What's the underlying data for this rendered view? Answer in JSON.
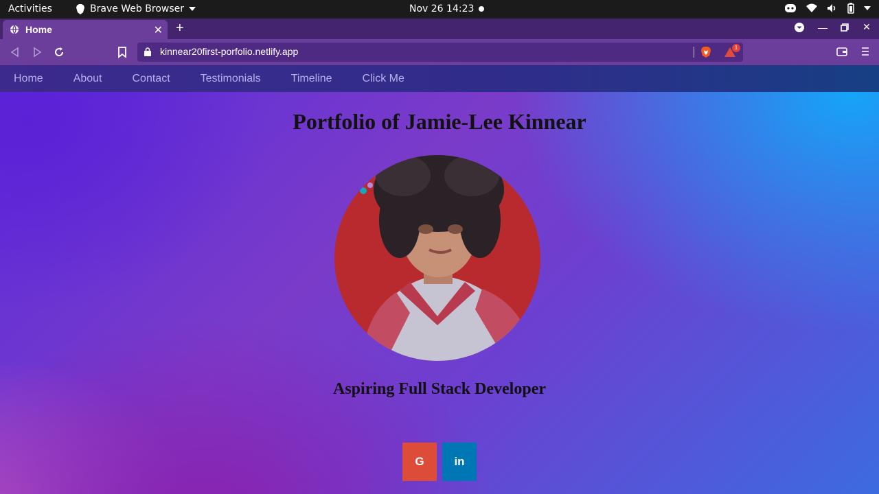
{
  "system": {
    "activities": "Activities",
    "app_name": "Brave Web Browser",
    "clock": "Nov 26  14:23"
  },
  "browser": {
    "tab_title": "Home",
    "url": "kinnear20first-porfolio.netlify.app",
    "rewards_badge": "1"
  },
  "site": {
    "nav": [
      "Home",
      "About",
      "Contact",
      "Testimonials",
      "Timeline",
      "Click Me"
    ],
    "title": "Portfolio of Jamie-Lee Kinnear",
    "subtitle": "Aspiring Full Stack Developer",
    "social": {
      "google": "G",
      "linkedin": "in"
    }
  },
  "colors": {
    "google": "#dd4b39",
    "linkedin": "#0077b5",
    "tab_active": "#6a3e9a"
  }
}
